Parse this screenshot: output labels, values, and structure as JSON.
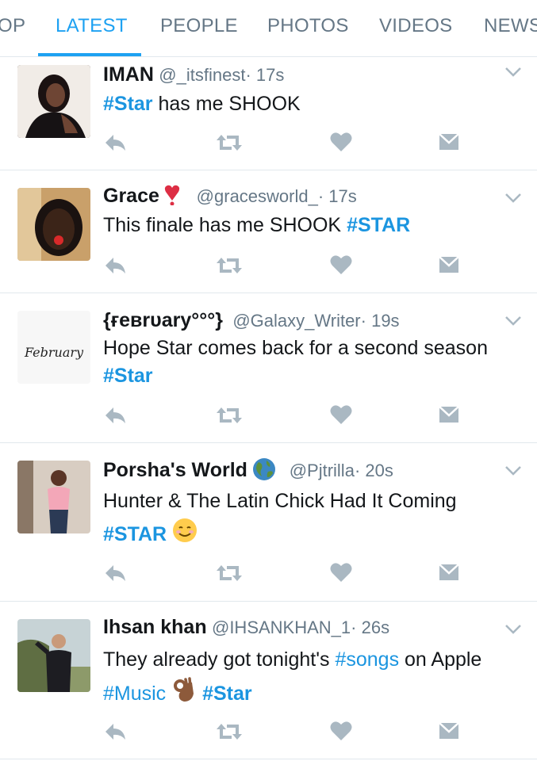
{
  "tabs": [
    {
      "label": "OP",
      "active": false
    },
    {
      "label": "LATEST",
      "active": true
    },
    {
      "label": "PEOPLE",
      "active": false
    },
    {
      "label": "PHOTOS",
      "active": false
    },
    {
      "label": "VIDEOS",
      "active": false
    },
    {
      "label": "NEWS",
      "active": false
    }
  ],
  "colors": {
    "accent": "#1da1f2",
    "hashtag": "#1b95e0",
    "muted": "#657786",
    "icon": "#aab8c2",
    "divider": "#e1e8ed"
  },
  "tweets": [
    {
      "name": "IMAN",
      "handle": "@_itsfinest",
      "time": "· 17s",
      "body": [
        {
          "text": "#Star",
          "type": "hashtag-bold"
        },
        {
          "text": " has me SHOOK",
          "type": "text"
        }
      ]
    },
    {
      "name": "Grace",
      "name_emoji": "heart-exclamation",
      "handle": "@gracesworld_",
      "time": "· 17s",
      "body": [
        {
          "text": "This finale has me SHOOK ",
          "type": "text"
        },
        {
          "text": "#STAR",
          "type": "hashtag-bold"
        }
      ]
    },
    {
      "name": "{ғeвrυary°°°}",
      "handle": "@Galaxy_Writer",
      "time": "· 19s",
      "avatar_text": "February",
      "body": [
        {
          "text": "Hope Star comes back for a second season ",
          "type": "text"
        },
        {
          "text": "#Star",
          "type": "hashtag-bold"
        }
      ]
    },
    {
      "name": "Porsha's World",
      "name_emoji": "globe",
      "handle": "@Pjtrilla",
      "time": "· 20s",
      "body": [
        {
          "text": "Hunter & The Latin Chick Had It Coming ",
          "type": "text"
        },
        {
          "text": "#STAR",
          "type": "hashtag-bold"
        },
        {
          "text": " ",
          "type": "text"
        },
        {
          "text": "☺",
          "type": "emoji-smile"
        }
      ]
    },
    {
      "name": "Ihsan khan",
      "handle": "@IHSANKHAN_1",
      "time": "· 26s",
      "body": [
        {
          "text": "They already got tonight's ",
          "type": "text"
        },
        {
          "text": "#songs",
          "type": "hashtag"
        },
        {
          "text": " on Apple ",
          "type": "text"
        },
        {
          "text": "#Music",
          "type": "hashtag"
        },
        {
          "text": " ",
          "type": "text"
        },
        {
          "text": "ok-hand",
          "type": "emoji-ok"
        },
        {
          "text": " ",
          "type": "text"
        },
        {
          "text": "#Star",
          "type": "hashtag-bold"
        }
      ]
    }
  ],
  "action_icons": [
    "reply-icon",
    "retweet-icon",
    "like-icon",
    "direct-message-icon"
  ]
}
